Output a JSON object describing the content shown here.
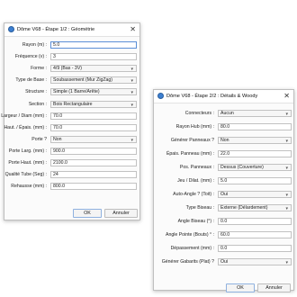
{
  "dialog1": {
    "title": "Dôme V68 - Étape 1/2 : Géométrie",
    "close_glyph": "✕",
    "fields": [
      {
        "label": "Rayon (m) :",
        "value": "5.0",
        "kind": "input"
      },
      {
        "label": "Fréquence (v) :",
        "value": "3",
        "kind": "input"
      },
      {
        "label": "Forme :",
        "value": "4/9 (Bas - 3V)",
        "kind": "select"
      },
      {
        "label": "Type de Base :",
        "value": "Soubassement (Mur ZigZag)",
        "kind": "select"
      },
      {
        "label": "Structure :",
        "value": "Simple (1 Barre/Arête)",
        "kind": "select"
      },
      {
        "label": "Section :",
        "value": "Bois Rectangulaire",
        "kind": "select"
      },
      {
        "label": "Largeur / Diam (mm) :",
        "value": "70.0",
        "kind": "input"
      },
      {
        "label": "Haut. / Épais. (mm) :",
        "value": "70.0",
        "kind": "input"
      },
      {
        "label": "Porte ?",
        "value": "Non",
        "kind": "select"
      },
      {
        "label": "Porte Larg. (mm) :",
        "value": "900.0",
        "kind": "input"
      },
      {
        "label": "Porte Haut. (mm) :",
        "value": "2100.0",
        "kind": "input"
      },
      {
        "label": "Qualité Tube (Seg) :",
        "value": "24",
        "kind": "input"
      },
      {
        "label": "Rehausse (mm) :",
        "value": "800.0",
        "kind": "input"
      }
    ],
    "ok_label": "OK",
    "cancel_label": "Annuler"
  },
  "dialog2": {
    "title": "Dôme V68 - Étape 2/2 : Détails & Woody",
    "close_glyph": "✕",
    "fields": [
      {
        "label": "Connecteurs :",
        "value": "Aucun",
        "kind": "select"
      },
      {
        "label": "Rayon Hub (mm) :",
        "value": "80.0",
        "kind": "input"
      },
      {
        "label": "Générer Panneaux ?",
        "value": "Non",
        "kind": "select"
      },
      {
        "label": "Épais. Panneau (mm) :",
        "value": "22.0",
        "kind": "input"
      },
      {
        "label": "Pos. Panneaux :",
        "value": "Dessus (Couverture)",
        "kind": "select"
      },
      {
        "label": "Jeu / Dilat. (mm) :",
        "value": "5.0",
        "kind": "input"
      },
      {
        "label": "Auto-Angle ? (Toit) :",
        "value": "Oui",
        "kind": "select"
      },
      {
        "label": "Type Biseau :",
        "value": "Externe (Délardement)",
        "kind": "select"
      },
      {
        "label": "Angle Biseau (°) :",
        "value": "0.0",
        "kind": "input"
      },
      {
        "label": "Angle Pointe (Bouts) ° :",
        "value": "60.0",
        "kind": "input"
      },
      {
        "label": "Dépassement (mm) :",
        "value": "0.0",
        "kind": "input"
      },
      {
        "label": "Générer Gabarits (Plat) ?",
        "value": "Oui",
        "kind": "select"
      }
    ],
    "ok_label": "OK",
    "cancel_label": "Annuler"
  },
  "icons": {
    "dropdown_caret": "chevron-down-icon",
    "close": "close-icon",
    "app": "dome-app-icon"
  }
}
